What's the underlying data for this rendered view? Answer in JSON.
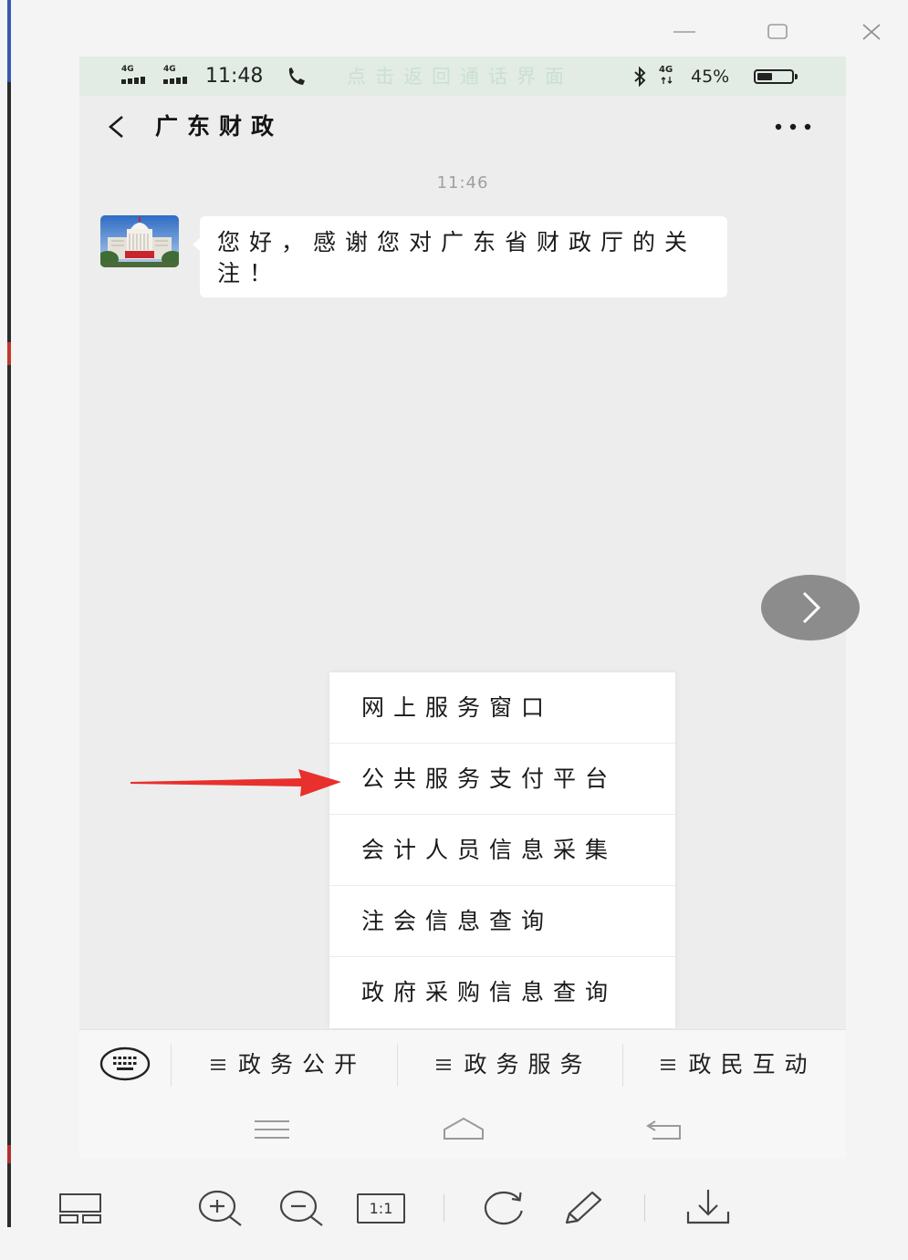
{
  "viewer": {
    "window_controls": {
      "minimize_icon": "minimize-icon",
      "maximize_icon": "maximize-icon",
      "close_icon": "close-icon"
    },
    "next_button_icon": "chevron-right-icon",
    "toolbar": {
      "thumbnails_icon": "filmstrip-icon",
      "zoom_in_icon": "zoom-in-icon",
      "zoom_out_icon": "zoom-out-icon",
      "actual_size_label": "1:1",
      "rotate_icon": "rotate-icon",
      "edit_icon": "pencil-icon",
      "download_icon": "download-icon"
    },
    "annotation_icon": "red-arrow-icon"
  },
  "phone": {
    "status_bar": {
      "signal_labels": [
        "4G",
        "4G"
      ],
      "time": "11:48",
      "call_icon": "phone-call-icon",
      "call_banner": "点击返回通话界面",
      "bluetooth_icon": "bluetooth-icon",
      "data_label": "4G",
      "battery_percent": "45%",
      "battery_level": 0.45
    },
    "header": {
      "back_icon": "chevron-left-icon",
      "title": "广东财政",
      "more_icon": "more-horizontal-icon"
    },
    "chat": {
      "timestamp": "11:46",
      "avatar_icon": "account-avatar",
      "messages": [
        {
          "text": "您好，感谢您对广东省财政厅的关注！"
        }
      ]
    },
    "popup_menu": {
      "items": [
        "网上服务窗口",
        "公共服务支付平台",
        "会计人员信息采集",
        "注会信息查询",
        "政府采购信息查询"
      ]
    },
    "bottom_menu": {
      "keyboard_icon": "keyboard-icon",
      "items": [
        {
          "icon": "menu-icon",
          "label": "政务公开"
        },
        {
          "icon": "menu-icon",
          "label": "政务服务"
        },
        {
          "icon": "menu-icon",
          "label": "政民互动"
        }
      ]
    },
    "nav_bar": {
      "recents_icon": "menu-icon",
      "home_icon": "home-icon",
      "back_icon": "back-icon"
    }
  },
  "colors": {
    "viewer_bg": "#f4f4f4",
    "status_bar_bg": "#e2ece5",
    "chat_bg": "#ededed",
    "bubble_bg": "#ffffff",
    "bottom_bar_bg": "#f7f7f7",
    "annotation_arrow": "#e8302c",
    "next_button_bg": "#8c8c8c"
  }
}
